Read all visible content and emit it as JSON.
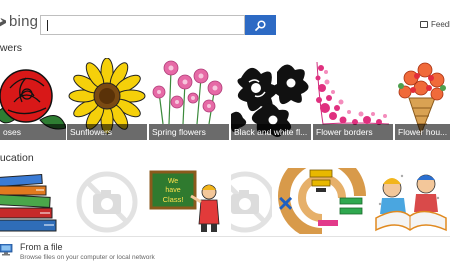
{
  "header": {
    "brand": "bing",
    "search": {
      "value": "",
      "placeholder": ""
    },
    "feedback_label": "Feedb"
  },
  "sections": [
    {
      "title": "owers",
      "tiles": [
        {
          "label": "oses",
          "subject": "red rose"
        },
        {
          "label": "Sunflowers",
          "subject": "sunflower"
        },
        {
          "label": "Spring flowers",
          "subject": "pink flowers"
        },
        {
          "label": "Black and white fl...",
          "subject": "black and white flowers"
        },
        {
          "label": "Flower borders",
          "subject": "pink flower border"
        },
        {
          "label": "Flower hou...",
          "subject": "flower bouquet"
        }
      ]
    },
    {
      "title": "ducation",
      "tiles": [
        {
          "label": "",
          "subject": "stack of books"
        },
        {
          "label": "",
          "subject": "image placeholder"
        },
        {
          "label": "",
          "subject": "teacher at board"
        },
        {
          "label": "",
          "subject": "image placeholder"
        },
        {
          "label": "",
          "subject": "math symbols"
        },
        {
          "label": "",
          "subject": "children reading"
        }
      ]
    }
  ],
  "education_board_text": [
    "We",
    "have",
    "Class!"
  ],
  "file_option": {
    "title": "From a file",
    "subtitle": "Browse files on your computer or local network"
  },
  "colors": {
    "search_button": "#2d6ac4",
    "caption_overlay": "rgba(0,0,0,0.58)"
  }
}
